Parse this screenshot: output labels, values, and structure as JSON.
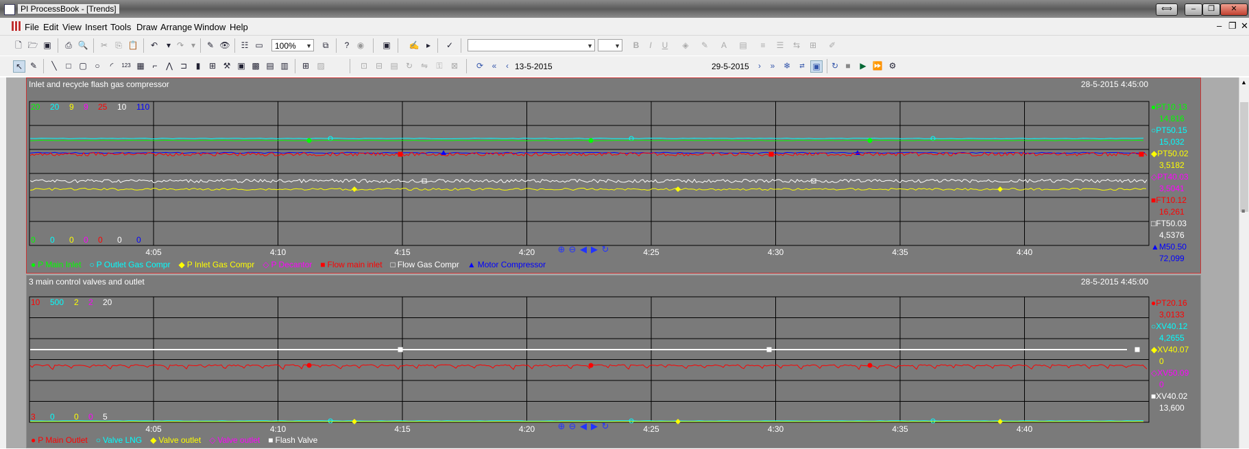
{
  "window": {
    "title": "PI ProcessBook - [Trends]"
  },
  "menu": [
    "File",
    "Edit",
    "View",
    "Insert",
    "Tools",
    "Draw",
    "Arrange",
    "Window",
    "Help"
  ],
  "toolbar": {
    "zoom": "100%",
    "start_time": "13-5-2015",
    "end_time": "29-5-2015"
  },
  "colors": {
    "green": "#00ff00",
    "cyan": "#00ffff",
    "yellow": "#ffff00",
    "magenta": "#ff00ff",
    "red": "#ff0000",
    "white": "#ffffff",
    "blue": "#0000ff"
  },
  "trend1": {
    "title": "Inlet and recycle flash gas compressor",
    "date": "28-5-2015 4:45:00",
    "x_ticks": [
      "4:05",
      "4:10",
      "4:15",
      "4:20",
      "4:25",
      "4:30",
      "4:35",
      "4:40"
    ],
    "scale_max": [
      {
        "t": "20",
        "c": "green"
      },
      {
        "t": "20",
        "c": "cyan"
      },
      {
        "t": "9",
        "c": "yellow"
      },
      {
        "t": "9",
        "c": "magenta"
      },
      {
        "t": "25",
        "c": "red"
      },
      {
        "t": "10",
        "c": "white"
      },
      {
        "t": "110",
        "c": "blue"
      }
    ],
    "scale_min": [
      {
        "t": "0",
        "c": "green"
      },
      {
        "t": "0",
        "c": "cyan"
      },
      {
        "t": "0",
        "c": "yellow"
      },
      {
        "t": "0",
        "c": "magenta"
      },
      {
        "t": "0",
        "c": "red"
      },
      {
        "t": "0",
        "c": "white"
      },
      {
        "t": "0",
        "c": "blue"
      }
    ],
    "legend": [
      {
        "sym": "●",
        "name": "P Main Inlet",
        "c": "green"
      },
      {
        "sym": "○",
        "name": "P Outlet Gas Compr",
        "c": "cyan"
      },
      {
        "sym": "◆",
        "name": "P Inlet Gas Compr",
        "c": "yellow"
      },
      {
        "sym": "◇",
        "name": "P Decantor",
        "c": "magenta"
      },
      {
        "sym": "■",
        "name": "Flow main inlet",
        "c": "red"
      },
      {
        "sym": "□",
        "name": "Flow Gas Compr",
        "c": "white"
      },
      {
        "sym": "▲",
        "name": "Motor Compressor",
        "c": "blue"
      }
    ],
    "values": [
      {
        "sym": "●",
        "tag": "PT10.13",
        "value": "14,816",
        "c": "green"
      },
      {
        "sym": "○",
        "tag": "PT50.15",
        "value": "15,032",
        "c": "cyan"
      },
      {
        "sym": "◆",
        "tag": "PT50.02",
        "value": "3,5182",
        "c": "yellow"
      },
      {
        "sym": "◇",
        "tag": "PT40.03",
        "value": "3,5041",
        "c": "magenta"
      },
      {
        "sym": "■",
        "tag": "FT10.12",
        "value": "16,261",
        "c": "red"
      },
      {
        "sym": "□",
        "tag": "FT50.03",
        "value": "4,5376",
        "c": "white"
      },
      {
        "sym": "▲",
        "tag": "M50.50",
        "value": "72,099",
        "c": "blue"
      }
    ]
  },
  "trend2": {
    "title": "3 main control valves and outlet",
    "date": "28-5-2015 4:45:00",
    "x_ticks": [
      "4:05",
      "4:10",
      "4:15",
      "4:20",
      "4:25",
      "4:30",
      "4:35",
      "4:40"
    ],
    "scale_max": [
      {
        "t": "10",
        "c": "red"
      },
      {
        "t": "500",
        "c": "cyan"
      },
      {
        "t": "2",
        "c": "yellow"
      },
      {
        "t": "2",
        "c": "magenta"
      },
      {
        "t": "20",
        "c": "white"
      }
    ],
    "scale_min": [
      {
        "t": "3",
        "c": "red"
      },
      {
        "t": "0",
        "c": "cyan"
      },
      {
        "t": "0",
        "c": "yellow"
      },
      {
        "t": "0",
        "c": "magenta"
      },
      {
        "t": "5",
        "c": "white"
      }
    ],
    "legend": [
      {
        "sym": "●",
        "name": "P Main Outlet",
        "c": "red"
      },
      {
        "sym": "○",
        "name": "Valve LNG",
        "c": "cyan"
      },
      {
        "sym": "◆",
        "name": "Valve outlet",
        "c": "yellow"
      },
      {
        "sym": "◇",
        "name": "Valve outlet",
        "c": "magenta"
      },
      {
        "sym": "■",
        "name": "Flash Valve",
        "c": "white"
      }
    ],
    "values": [
      {
        "sym": "●",
        "tag": "PT20.16",
        "value": "3,0133",
        "c": "red"
      },
      {
        "sym": "○",
        "tag": "XV40.12",
        "value": "4,2655",
        "c": "cyan"
      },
      {
        "sym": "◆",
        "tag": "XV40.07",
        "value": "0",
        "c": "yellow"
      },
      {
        "sym": "◇",
        "tag": "XV50.09",
        "value": "0",
        "c": "magenta"
      },
      {
        "sym": "■",
        "tag": "XV40.02",
        "value": "13,600",
        "c": "white"
      }
    ]
  }
}
